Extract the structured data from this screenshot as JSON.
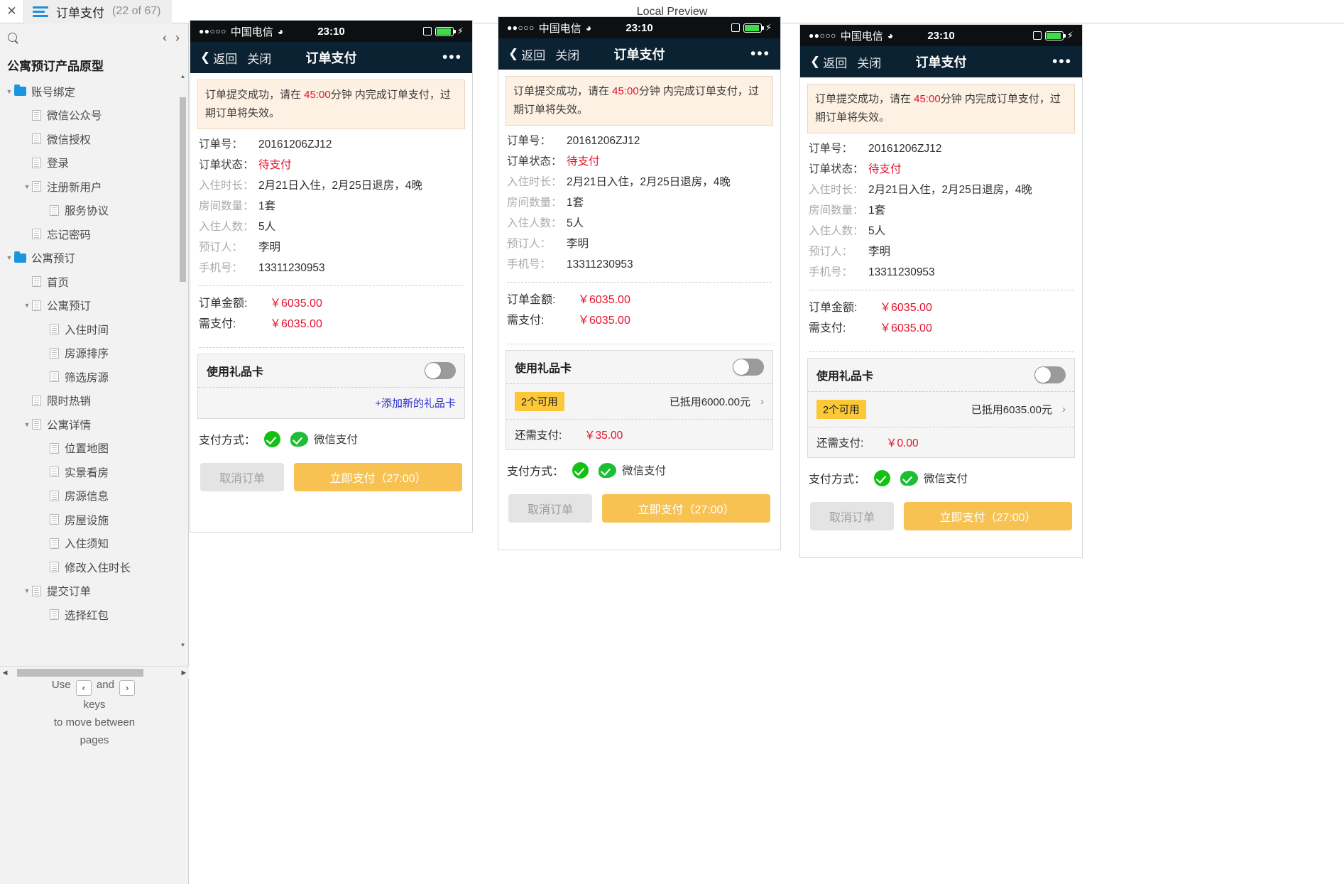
{
  "topbar": {
    "close_icon": "close-icon",
    "menu_icon": "hamburger-icon",
    "title": "订单支付",
    "count": "(22 of 67)",
    "preview_label": "Local Preview"
  },
  "sidebar": {
    "search_icon": "search-icon",
    "prev_label": "‹",
    "next_label": "›",
    "project_title": "公寓预订产品原型",
    "tree": [
      {
        "label": "账号绑定",
        "level": 0,
        "icon": "folder",
        "caret": "▼"
      },
      {
        "label": "微信公众号",
        "level": 1,
        "icon": "page",
        "caret": ""
      },
      {
        "label": "微信授权",
        "level": 1,
        "icon": "page",
        "caret": ""
      },
      {
        "label": "登录",
        "level": 1,
        "icon": "page",
        "caret": ""
      },
      {
        "label": "注册新用户",
        "level": 1,
        "icon": "page",
        "caret": "▼"
      },
      {
        "label": "服务协议",
        "level": 2,
        "icon": "page",
        "caret": ""
      },
      {
        "label": "忘记密码",
        "level": 1,
        "icon": "page",
        "caret": ""
      },
      {
        "label": "公寓预订",
        "level": 0,
        "icon": "folder",
        "caret": "▼"
      },
      {
        "label": "首页",
        "level": 1,
        "icon": "page",
        "caret": ""
      },
      {
        "label": "公寓预订",
        "level": 1,
        "icon": "page",
        "caret": "▼"
      },
      {
        "label": "入住时间",
        "level": 2,
        "icon": "page",
        "caret": ""
      },
      {
        "label": "房源排序",
        "level": 2,
        "icon": "page",
        "caret": ""
      },
      {
        "label": "筛选房源",
        "level": 2,
        "icon": "page",
        "caret": ""
      },
      {
        "label": "限时热销",
        "level": 1,
        "icon": "page",
        "caret": ""
      },
      {
        "label": "公寓详情",
        "level": 1,
        "icon": "page",
        "caret": "▼"
      },
      {
        "label": "位置地图",
        "level": 2,
        "icon": "page",
        "caret": ""
      },
      {
        "label": "实景看房",
        "level": 2,
        "icon": "page",
        "caret": ""
      },
      {
        "label": "房源信息",
        "level": 2,
        "icon": "page",
        "caret": ""
      },
      {
        "label": "房屋设施",
        "level": 2,
        "icon": "page",
        "caret": ""
      },
      {
        "label": "入住须知",
        "level": 2,
        "icon": "page",
        "caret": ""
      },
      {
        "label": "修改入住时长",
        "level": 2,
        "icon": "page",
        "caret": ""
      },
      {
        "label": "提交订单",
        "level": 1,
        "icon": "page",
        "caret": "▼"
      },
      {
        "label": "选择红包",
        "level": 2,
        "icon": "page",
        "caret": ""
      }
    ],
    "hint": {
      "line1_a": "Use",
      "key_prev": "‹",
      "line1_b": "and",
      "key_next": "›",
      "line2": "keys",
      "line3": "to move between",
      "line4": "pages"
    }
  },
  "status_bar": {
    "signal_dots": "●●○○○",
    "carrier": "中国电信",
    "wifi_icon": "wifi-icon",
    "time": "23:10",
    "lock_icon": "rotation-lock-icon",
    "battery_icon": "battery-icon",
    "charging_icon": "⚡"
  },
  "nav_bar": {
    "back_icon": "chevron-left-icon",
    "back_label": "返回",
    "close_label": "关闭",
    "title": "订单支付",
    "more_icon": "more-dots-icon",
    "more_label": "•••"
  },
  "alert": {
    "prefix": "订单提交成功，请在 ",
    "countdown": "45:00",
    "suffix": "分钟 内完成订单支付，过期订单将失效。"
  },
  "order": {
    "rows": [
      {
        "label": "订单号：",
        "value": "20161206ZJ12",
        "label_dark": true,
        "value_red": false
      },
      {
        "label": "订单状态：",
        "value": "待支付",
        "label_dark": true,
        "value_red": true
      },
      {
        "label": "入住时长：",
        "value": "2月21日入住，2月25日退房，4晚",
        "label_dark": false,
        "value_red": false
      },
      {
        "label": "房间数量：",
        "value": "1套",
        "label_dark": false,
        "value_red": false
      },
      {
        "label": "入住人数：",
        "value": "5人",
        "label_dark": false,
        "value_red": false
      },
      {
        "label": "预订人：",
        "value": "李明",
        "label_dark": false,
        "value_red": false
      },
      {
        "label": "手机号：",
        "value": "13311230953",
        "label_dark": false,
        "value_red": false
      }
    ],
    "amount_label": "订单金额:",
    "amount_value": "￥6035.00",
    "payable_label": "需支付:",
    "payable_value": "￥6035.00"
  },
  "gift_card": {
    "title": "使用礼品卡",
    "toggle_state": "off",
    "add_link": "+添加新的礼品卡",
    "badge": "2个可用",
    "chevron": "›",
    "rest_label": "还需支付:"
  },
  "payment": {
    "label": "支付方式：",
    "check_icon": "check-circle-icon",
    "wechat_icon": "wechat-pay-icon",
    "method": "微信支付"
  },
  "buttons": {
    "cancel": "取消订单",
    "pay": "立即支付（27:00）"
  },
  "panels": [
    {
      "id": "panel-1",
      "gift_variant": "add",
      "used_text": "",
      "rest_value": ""
    },
    {
      "id": "panel-2",
      "gift_variant": "applied",
      "used_text": "已抵用6000.00元",
      "rest_value": "￥35.00"
    },
    {
      "id": "panel-3",
      "gift_variant": "applied",
      "used_text": "已抵用6035.00元",
      "rest_value": "￥0.00"
    }
  ],
  "colors": {
    "accent_blue": "#1b95e0",
    "red": "#e8112d",
    "gold": "#f7c252",
    "badge": "#fcc838",
    "wechat_green": "#1fbd36",
    "navbar": "#0b2233"
  }
}
